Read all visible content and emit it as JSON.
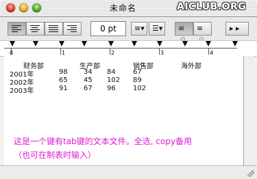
{
  "window": {
    "title": "未命名"
  },
  "watermark": "AICLUB.ORG",
  "toolbar": {
    "font_size_value": "0 pt",
    "alignment_buttons": [
      "align-left",
      "align-center",
      "justify",
      "align-right"
    ],
    "selected_alignment": "align-left"
  },
  "ruler": {
    "labels": [
      "0",
      "1",
      "2",
      "3",
      "4"
    ]
  },
  "table": {
    "headers": [
      "财务部",
      "生产部",
      "销售部",
      "海外部"
    ],
    "rows": [
      {
        "year": "2001年",
        "values": [
          "98",
          "34",
          "84",
          "67"
        ]
      },
      {
        "year": "2002年",
        "values": [
          "65",
          "45",
          "102",
          "89"
        ]
      },
      {
        "year": "2003年",
        "values": [
          "91",
          "67",
          "96",
          "102"
        ]
      }
    ]
  },
  "note": {
    "line1": "这是一个键有tab键的文本文件。全选, copy备用",
    "line2": "（也可在制表时输入）",
    "color": "#e01bd0"
  }
}
